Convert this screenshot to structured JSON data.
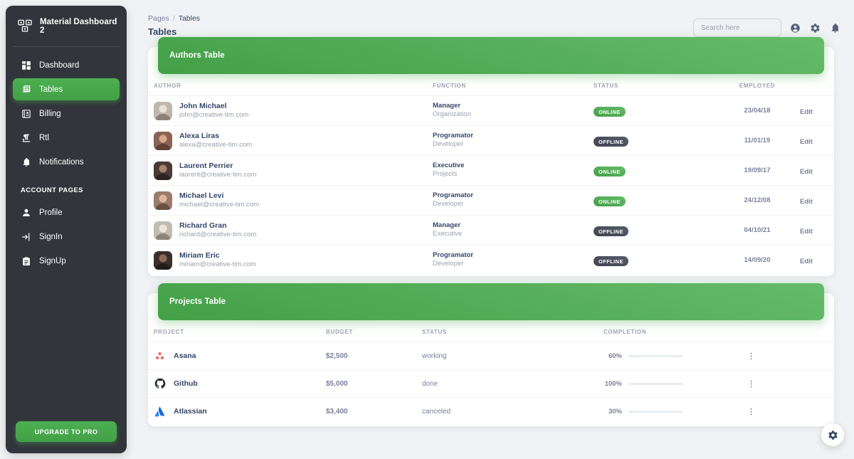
{
  "sidebar": {
    "brand": "Material Dashboard 2",
    "brand_logo_icon": "material-logo-icon",
    "nav": [
      {
        "label": "Dashboard",
        "icon": "dashboard-icon",
        "active": false
      },
      {
        "label": "Tables",
        "icon": "tables-icon",
        "active": true
      },
      {
        "label": "Billing",
        "icon": "billing-icon",
        "active": false
      },
      {
        "label": "Rtl",
        "icon": "rtl-icon",
        "active": false
      },
      {
        "label": "Notifications",
        "icon": "bell-icon",
        "active": false
      }
    ],
    "section_label": "ACCOUNT PAGES",
    "account_nav": [
      {
        "label": "Profile",
        "icon": "person-icon"
      },
      {
        "label": "SignIn",
        "icon": "login-icon"
      },
      {
        "label": "SignUp",
        "icon": "signup-icon"
      }
    ],
    "upgrade_label": "UPGRADE TO PRO",
    "bg_color": "#32353c",
    "accent_color": "#4CAF50"
  },
  "topbar": {
    "breadcrumb_root": "Pages",
    "breadcrumb_sep": "/",
    "breadcrumb_current": "Tables",
    "page_title": "Tables",
    "search_placeholder": "Search here",
    "search_value": "",
    "icons": [
      "account-circle-icon",
      "gear-icon",
      "bell-icon"
    ]
  },
  "authors_card": {
    "title": "Authors Table",
    "columns": [
      "AUTHOR",
      "FUNCTION",
      "STATUS",
      "EMPLOYED",
      ""
    ],
    "rows": [
      {
        "name": "John Michael",
        "email": "john@creative-tim.com",
        "role": "Manager",
        "dept": "Organization",
        "status": "ONLINE",
        "employed": "23/04/18",
        "action": "Edit",
        "avatar": "#c8c3bd"
      },
      {
        "name": "Alexa Liras",
        "email": "alexa@creative-tim.com",
        "role": "Programator",
        "dept": "Developer",
        "status": "OFFLINE",
        "employed": "11/01/19",
        "action": "Edit",
        "avatar": "#7d5b4e"
      },
      {
        "name": "Laurent Perrier",
        "email": "laurent@creative-tim.com",
        "role": "Executive",
        "dept": "Projects",
        "status": "ONLINE",
        "employed": "19/09/17",
        "action": "Edit",
        "avatar": "#4a3a35"
      },
      {
        "name": "Michael Levi",
        "email": "michael@creative-tim.com",
        "role": "Programator",
        "dept": "Developer",
        "status": "ONLINE",
        "employed": "24/12/08",
        "action": "Edit",
        "avatar": "#8d6e63"
      },
      {
        "name": "Richard Gran",
        "email": "richard@creative-tim.com",
        "role": "Manager",
        "dept": "Executive",
        "status": "OFFLINE",
        "employed": "04/10/21",
        "action": "Edit",
        "avatar": "#c8c3bd"
      },
      {
        "name": "Miriam Eric",
        "email": "miriam@creative-tim.com",
        "role": "Programator",
        "dept": "Developer",
        "status": "OFFLINE",
        "employed": "14/09/20",
        "action": "Edit",
        "avatar": "#3b2f2b"
      }
    ]
  },
  "projects_card": {
    "title": "Projects Table",
    "columns": [
      "PROJECT",
      "BUDGET",
      "STATUS",
      "COMPLETION",
      ""
    ],
    "rows": [
      {
        "project": "Asana",
        "icon": "asana-icon",
        "budget": "$2,500",
        "status": "working",
        "completion": "60%",
        "pct": 60,
        "bar_color": "#1A73E8"
      },
      {
        "project": "Github",
        "icon": "github-icon",
        "budget": "$5,000",
        "status": "done",
        "completion": "100%",
        "pct": 100,
        "bar_color": "#4CAF50"
      },
      {
        "project": "Atlassian",
        "icon": "atlassian-icon",
        "budget": "$3,400",
        "status": "canceled",
        "completion": "30%",
        "pct": 30,
        "bar_color": "#C62828"
      }
    ]
  },
  "fab": {
    "icon": "gear-icon"
  }
}
